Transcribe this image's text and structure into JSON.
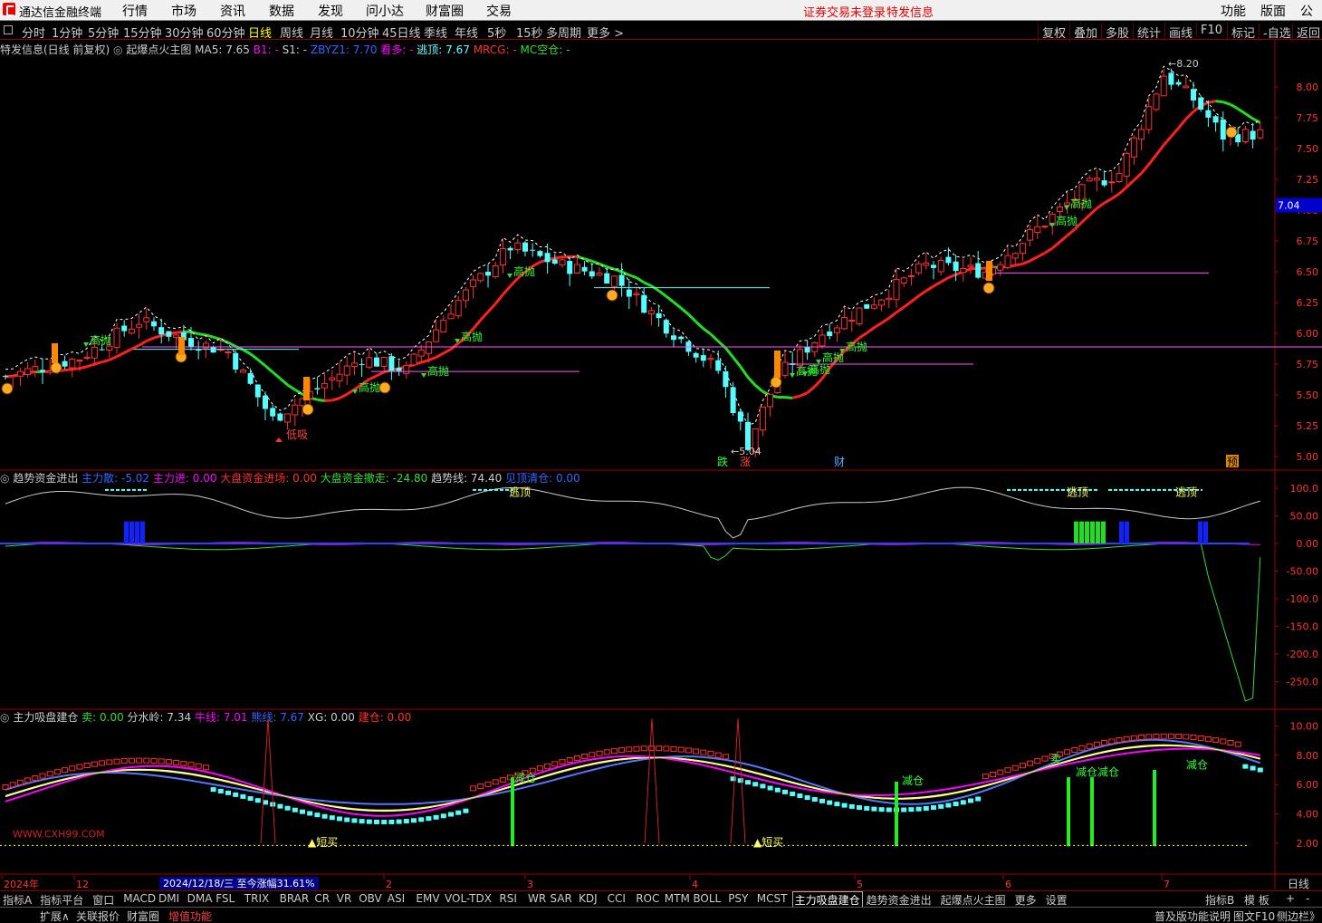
{
  "app": {
    "title": "通达信金融终端"
  },
  "menu": [
    "行情",
    "市场",
    "资讯",
    "数据",
    "发现",
    "问小达",
    "财富圈",
    "交易"
  ],
  "menu_warn": [
    "证券交易未登录",
    "特发信息"
  ],
  "menu_right": [
    "功能",
    "版面",
    "公式"
  ],
  "periods": [
    "分时",
    "1分钟",
    "5分钟",
    "15分钟",
    "30分钟",
    "60分钟",
    "日线",
    "周线",
    "月线",
    "10分钟",
    "45日线",
    "季线",
    "年线",
    "5秒",
    "15秒",
    "多周期",
    "更多 >"
  ],
  "active_period": "日线",
  "right_tools": [
    "复权",
    "叠加",
    "多股",
    "统计",
    "画线",
    "F10",
    "-自选",
    "返回"
  ],
  "main_header": {
    "stock": "特发信息(日线 前复权)",
    "indicator": "起爆点火主图",
    "items": [
      {
        "t": "MA5: 7.65",
        "c": "#cccccc"
      },
      {
        "t": "B1: -",
        "c": "#ff00ff"
      },
      {
        "t": "S1: -",
        "c": "#cccccc"
      },
      {
        "t": "ZBYZ1: 7.70",
        "c": "#3366ff"
      },
      {
        "t": "看多: -",
        "c": "#ff00ff"
      },
      {
        "t": "逃顶: 7.67",
        "c": "#66ffff"
      },
      {
        "t": "MRCG: -",
        "c": "#ff3030"
      },
      {
        "t": "MC空仓: -",
        "c": "#33dd33"
      }
    ]
  },
  "mid_header": {
    "title": "趋势资金进出",
    "items": [
      {
        "t": "主力散: -5.02",
        "c": "#3366ff"
      },
      {
        "t": "主力进: 0.00",
        "c": "#ff00ff"
      },
      {
        "t": "大盘资金进场: 0.00",
        "c": "#ff3030"
      },
      {
        "t": "大盘资金撤走: -24.80",
        "c": "#33dd33"
      },
      {
        "t": "趋势线: 74.40",
        "c": "#cccccc"
      },
      {
        "t": "见顶清仓: 0.00",
        "c": "#3366ff"
      }
    ]
  },
  "bot_header": {
    "title": "主力吸盘建仓",
    "items": [
      {
        "t": "卖: 0.00",
        "c": "#33dd33"
      },
      {
        "t": "分水岭: 7.34",
        "c": "#cccccc"
      },
      {
        "t": "牛线: 7.01",
        "c": "#ff00ff"
      },
      {
        "t": "熊线: 7.67",
        "c": "#3366ff"
      },
      {
        "t": "XG: 0.00",
        "c": "#cccccc"
      },
      {
        "t": "建仓: 0.00",
        "c": "#ff3030"
      }
    ]
  },
  "price_axis": [
    "8.00",
    "7.75",
    "7.50",
    "7.25",
    "7.00",
    "6.75",
    "6.50",
    "6.25",
    "6.00",
    "5.75",
    "5.50",
    "5.25",
    "5.00"
  ],
  "current_price": "7.04",
  "mid_axis": [
    "100.0",
    "50.00",
    "0.00",
    "-50.00",
    "-100.0",
    "-150.0",
    "-200.0",
    "-250.0"
  ],
  "bot_axis": [
    "10.00",
    "8.00",
    "6.00",
    "4.00",
    "2.00"
  ],
  "date_labels": [
    "2024年",
    "12",
    "2",
    "3",
    "4",
    "5",
    "6",
    "7"
  ],
  "date_info": "2024/12/18/三 至今涨幅31.61%",
  "main_labels": {
    "gaopao": "高抛",
    "dixi": "低吸",
    "low_price": "←5.04",
    "high_price": "←8.20",
    "die": "跌",
    "zhang": "涨",
    "cai": "财",
    "yu": "预"
  },
  "mid_labels": {
    "taoding": "逃顶"
  },
  "bot_labels": {
    "duanmai": "短买",
    "jiancang": "减仓",
    "mai": "卖",
    "watermark": "WWW.CXH99.COM"
  },
  "bottom_tabs": [
    "指标A",
    "指标平台",
    "窗口",
    "MACD",
    "DMI",
    "DMA",
    "FSL",
    "TRIX",
    "BRAR",
    "CR",
    "VR",
    "OBV",
    "ASI",
    "EMV",
    "VOL-TDX",
    "RSI",
    "WR",
    "SAR",
    "KDJ",
    "CCI",
    "ROC",
    "MTM",
    "BOLL",
    "PSY",
    "MCST",
    "主力吸盘建仓",
    "趋势资金进出",
    "起爆点火主图",
    "更多",
    "设置"
  ],
  "bottom_right": [
    "指标B",
    "模 板",
    "+",
    "-"
  ],
  "status": [
    "扩展∧",
    "关联报价",
    "财富圈",
    "增值功能"
  ],
  "status_right": [
    "普及版功能说明",
    "图文F10",
    "侧边栏》"
  ],
  "timeframe_label": "日线",
  "chart_data": {
    "type": "candlestick",
    "title": "特发信息(日线 前复权)",
    "ylim": [
      4.95,
      8.25
    ],
    "x_labels": [
      "2024年",
      "12",
      "2",
      "3",
      "4",
      "5",
      "6",
      "7"
    ],
    "low": 5.04,
    "high": 8.2,
    "last": 7.65
  }
}
